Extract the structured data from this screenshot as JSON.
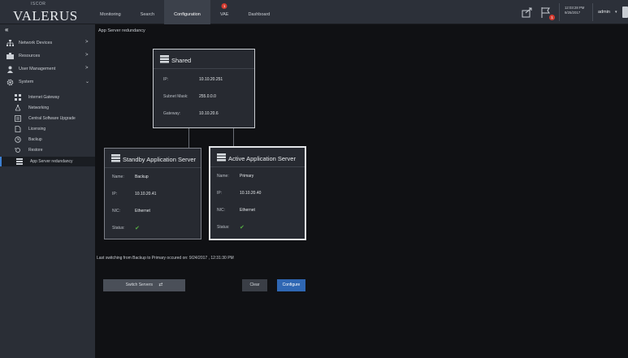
{
  "logo": {
    "mark": "ISCOR",
    "name": "VALERUS"
  },
  "nav": {
    "items": [
      {
        "label": "Monitoring",
        "active": false
      },
      {
        "label": "Search",
        "active": false
      },
      {
        "label": "Configuration",
        "active": true
      },
      {
        "label": "VAE",
        "active": false,
        "badge": "1"
      },
      {
        "label": "Dashboard",
        "active": false
      }
    ]
  },
  "topbar": {
    "clock_time": "12:03:28 PM",
    "clock_date": "9/25/2017",
    "alarm_badge": "1",
    "user": "admin",
    "user_caret": "▾"
  },
  "sidebar": {
    "collapse": "«",
    "items": [
      {
        "label": "Network Devices",
        "caret": ">"
      },
      {
        "label": "Resources",
        "caret": ">"
      },
      {
        "label": "User Management",
        "caret": ">"
      },
      {
        "label": "System",
        "caret": "⌄"
      }
    ],
    "sub_items": [
      {
        "label": "Internet Gateway",
        "icon": "gateway-icon"
      },
      {
        "label": "Networking",
        "icon": "network-icon"
      },
      {
        "label": "Central Software Upgrade",
        "icon": "upgrade-icon"
      },
      {
        "label": "Licensing",
        "icon": "license-icon"
      },
      {
        "label": "Backup",
        "icon": "backup-icon"
      },
      {
        "label": "Restore",
        "icon": "restore-icon"
      },
      {
        "label": "App Server redundancy",
        "icon": "server-icon",
        "active": true
      }
    ]
  },
  "breadcrumb": "App Server redundancy",
  "shared": {
    "title": "Shared",
    "ip_label": "IP:",
    "ip_value": "10.10.20.251",
    "mask_label": "Subnet Mask:",
    "mask_value": "255.0.0.0",
    "gateway_label": "Gateway:",
    "gateway_value": "10.10.20.6"
  },
  "standby": {
    "title": "Standby Application Server",
    "name_label": "Name:",
    "name_value": "Backup",
    "ip_label": "IP:",
    "ip_value": "10.10.20.41",
    "nic_label": "NIC:",
    "nic_value": "Ethernet",
    "status_label": "Status:",
    "status_icon": "✔"
  },
  "active": {
    "title": "Active Application Server",
    "name_label": "Name:",
    "name_value": "Primary",
    "ip_label": "IP:",
    "ip_value": "10.10.20.40",
    "nic_label": "NIC:",
    "nic_value": "Ethernet",
    "status_label": "Status:",
    "status_icon": "✔"
  },
  "footer_text": "Last switching from Backup to Primary occured on: 9/24/2017 , 12:31:30 PM",
  "buttons": {
    "switch": "Switch Servers",
    "switch_icon": "⇄",
    "clear": "Clear",
    "configure": "Configure"
  },
  "colors": {
    "accent": "#2f67b3",
    "status_ok": "#57b043",
    "badge": "#d33a2f"
  }
}
